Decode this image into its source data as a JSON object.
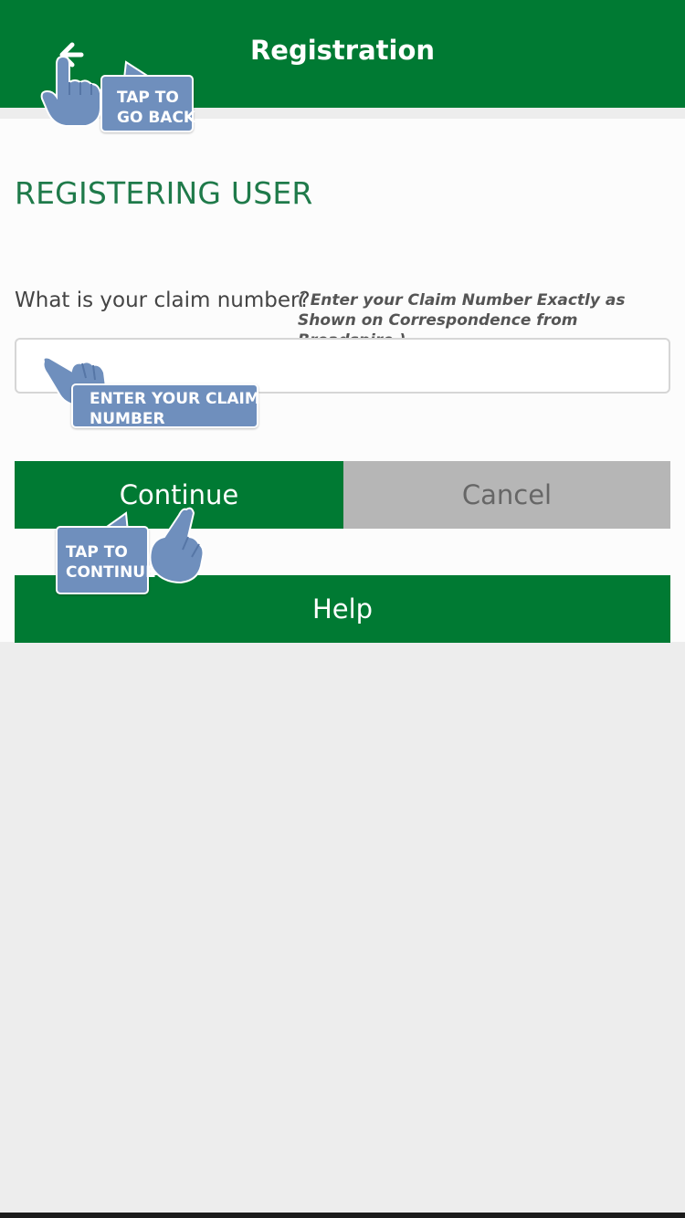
{
  "header": {
    "title": "Registration",
    "back_icon": "arrow-left-icon",
    "background_color": "#007a33"
  },
  "content": {
    "page_title": "REGISTERING USER",
    "question": "What is your claim number?",
    "hint": "( Enter your Claim Number Exactly as Shown on Correspondence from Broadspire )",
    "claim_input": {
      "value": "",
      "placeholder": ""
    }
  },
  "buttons": {
    "continue_label": "Continue",
    "cancel_label": "Cancel",
    "help_label": "Help"
  },
  "callouts": {
    "back": [
      "TAP TO",
      "GO BACK"
    ],
    "claim": [
      "ENTER YOUR CLAIM",
      "NUMBER"
    ],
    "continue": [
      "TAP TO",
      "CONTINUE"
    ],
    "color": "#6f8fbd",
    "hand_icon": "pointing-hand-icon"
  },
  "colors": {
    "brand_green": "#007a33",
    "title_green": "#1f7a4a",
    "cancel_gray": "#b6b6b6",
    "page_background": "#ededed"
  }
}
